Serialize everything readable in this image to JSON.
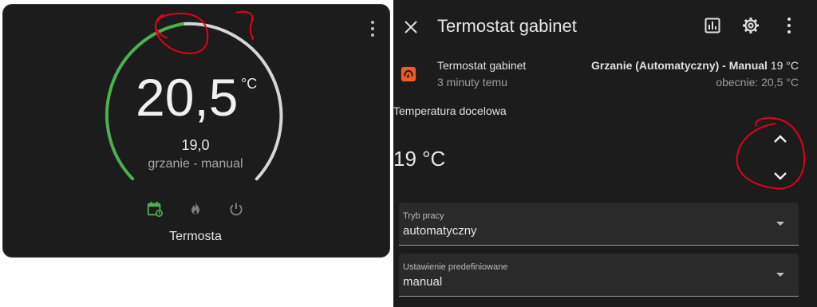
{
  "card": {
    "current_temp": "20,5",
    "unit": "°C",
    "target_temp": "19,0",
    "mode_text": "grzanie - manual",
    "name": "Termosta",
    "icons": [
      "calendar-sync-icon",
      "fire-icon",
      "power-icon"
    ],
    "colors": {
      "arc_active": "#4caf50",
      "arc_inactive": "#d6d6d6",
      "icon_active": "#4caf50",
      "icon_inactive": "#8a8a8a"
    }
  },
  "dialog": {
    "title": "Termostat gabinet",
    "entity": {
      "name": "Termostat gabinet",
      "last_changed": "3 minuty temu",
      "state_bold": "Grzanie (Automatyczny) - Manual",
      "state_temp": "19 °C",
      "current": "obecnie: 20,5 °C"
    },
    "target_label": "Temperatura docelowa",
    "target_value": "19 °C",
    "hvac_mode": {
      "label": "Tryb pracy",
      "value": "automatyczny"
    },
    "preset": {
      "label": "Ustawienie predefiniowane",
      "value": "manual"
    },
    "colors": {
      "entity_icon": "#ef5a28"
    }
  },
  "annotations": {
    "color": "#e3001a"
  }
}
